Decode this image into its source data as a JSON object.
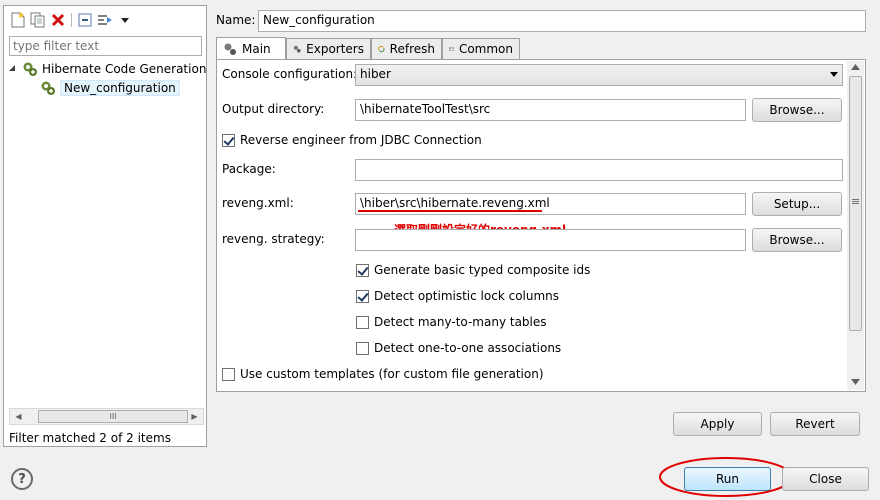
{
  "left": {
    "filter_placeholder": "type filter text",
    "tree": {
      "root": "Hibernate Code Generation",
      "child": "New_configuration"
    },
    "scrollbar_grip": "III",
    "status": "Filter matched 2 of 2 items"
  },
  "name_label": "Name:",
  "name_value": "New_configuration",
  "tabs": [
    "Main",
    "Exporters",
    "Refresh",
    "Common"
  ],
  "main": {
    "console_config_label": "Console configuration:",
    "console_config_value": "hiber",
    "output_dir_label": "Output directory:",
    "output_dir_value": "\\hibernateToolTest\\src",
    "browse_label": "Browse...",
    "reverse_engineer_label": "Reverse engineer from JDBC Connection",
    "package_label": "Package:",
    "package_value": "",
    "reveng_xml_label": "reveng.xml:",
    "reveng_xml_value": "\\hiber\\src\\hibernate.reveng.xml",
    "setup_label": "Setup...",
    "annotation": "選取剛剛設定好的reveng.xml",
    "reveng_strategy_label": "reveng. strategy:",
    "reveng_strategy_value": "",
    "options": [
      {
        "label": "Generate basic typed composite ids",
        "checked": true
      },
      {
        "label": "Detect optimistic lock columns",
        "checked": true
      },
      {
        "label": "Detect many-to-many tables",
        "checked": false
      },
      {
        "label": "Detect one-to-one associations",
        "checked": false
      }
    ],
    "custom_templates_label": "Use custom templates (for custom file generation)",
    "scroll_grip": "≡"
  },
  "buttons": {
    "apply": "Apply",
    "revert": "Revert",
    "run": "Run",
    "close": "Close",
    "help": "?"
  },
  "colors": {
    "annotation_red": "#e00000",
    "run_border": "#3c7fb1",
    "selection": "#e5f3fb"
  }
}
